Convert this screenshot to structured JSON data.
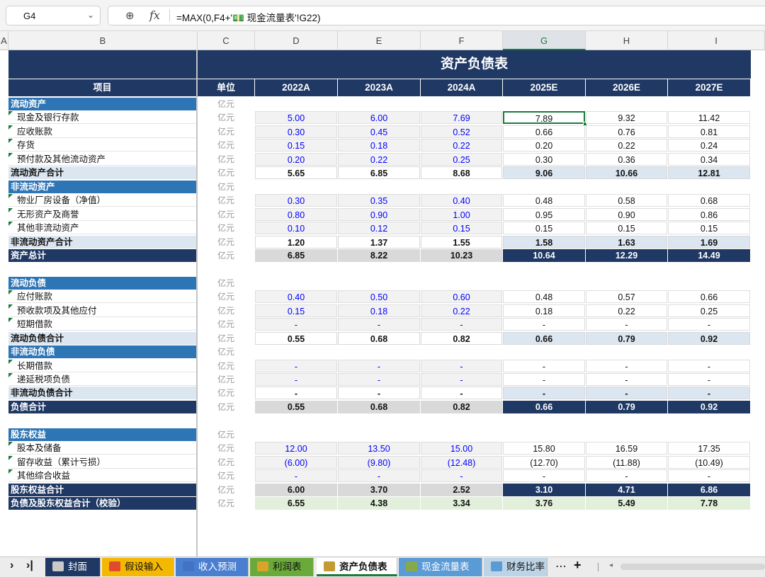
{
  "formula_bar": {
    "cell_ref": "G4",
    "formula": "=MAX(0,F4+'💵 现金流量表'!G22)",
    "zoom_icon": "zoom-icon",
    "fx_label": "fx"
  },
  "columns": [
    "A",
    "B",
    "C",
    "D",
    "E",
    "F",
    "G",
    "H",
    "I"
  ],
  "selected_column": "G",
  "sheet": {
    "title": "资产负债表",
    "header": {
      "item": "项目",
      "unit": "单位",
      "years": [
        "2022A",
        "2023A",
        "2024A",
        "2025E",
        "2026E",
        "2027E"
      ]
    },
    "rows": [
      {
        "label": "流动资产",
        "type": "section",
        "unit": "亿元",
        "values": [
          "",
          "",
          "",
          "",
          "",
          ""
        ]
      },
      {
        "label": "现金及银行存款",
        "type": "item",
        "unit": "亿元",
        "values": [
          "5.00",
          "6.00",
          "7.69",
          "7.89",
          "9.32",
          "11.42"
        ]
      },
      {
        "label": "应收账款",
        "type": "item",
        "unit": "亿元",
        "values": [
          "0.30",
          "0.45",
          "0.52",
          "0.66",
          "0.76",
          "0.81"
        ]
      },
      {
        "label": "存货",
        "type": "item",
        "unit": "亿元",
        "values": [
          "0.15",
          "0.18",
          "0.22",
          "0.20",
          "0.22",
          "0.24"
        ]
      },
      {
        "label": "预付款及其他流动资产",
        "type": "item",
        "unit": "亿元",
        "values": [
          "0.20",
          "0.22",
          "0.25",
          "0.30",
          "0.36",
          "0.34"
        ]
      },
      {
        "label": "流动资产合计",
        "type": "subtotal",
        "unit": "亿元",
        "values": [
          "5.65",
          "6.85",
          "8.68",
          "9.06",
          "10.66",
          "12.81"
        ]
      },
      {
        "label": "非流动资产",
        "type": "section",
        "unit": "亿元",
        "values": [
          "",
          "",
          "",
          "",
          "",
          ""
        ]
      },
      {
        "label": "物业厂房设备（净值）",
        "type": "item",
        "unit": "亿元",
        "values": [
          "0.30",
          "0.35",
          "0.40",
          "0.48",
          "0.58",
          "0.68"
        ]
      },
      {
        "label": "无形资产及商誉",
        "type": "item",
        "unit": "亿元",
        "values": [
          "0.80",
          "0.90",
          "1.00",
          "0.95",
          "0.90",
          "0.86"
        ]
      },
      {
        "label": "其他非流动资产",
        "type": "item",
        "unit": "亿元",
        "values": [
          "0.10",
          "0.12",
          "0.15",
          "0.15",
          "0.15",
          "0.15"
        ]
      },
      {
        "label": "非流动资产合计",
        "type": "subtotal",
        "unit": "亿元",
        "values": [
          "1.20",
          "1.37",
          "1.55",
          "1.58",
          "1.63",
          "1.69"
        ]
      },
      {
        "label": "资产总计",
        "type": "total",
        "unit": "亿元",
        "values": [
          "6.85",
          "8.22",
          "10.23",
          "10.64",
          "12.29",
          "14.49"
        ]
      },
      {
        "label": "",
        "type": "blank",
        "unit": "",
        "values": [
          "",
          "",
          "",
          "",
          "",
          ""
        ]
      },
      {
        "label": "流动负债",
        "type": "section",
        "unit": "亿元",
        "values": [
          "",
          "",
          "",
          "",
          "",
          ""
        ]
      },
      {
        "label": "应付账款",
        "type": "item",
        "unit": "亿元",
        "values": [
          "0.40",
          "0.50",
          "0.60",
          "0.48",
          "0.57",
          "0.66"
        ]
      },
      {
        "label": "预收款项及其他应付",
        "type": "item",
        "unit": "亿元",
        "values": [
          "0.15",
          "0.18",
          "0.22",
          "0.18",
          "0.22",
          "0.25"
        ]
      },
      {
        "label": "短期借款",
        "type": "item",
        "unit": "亿元",
        "values": [
          "-",
          "-",
          "-",
          "-",
          "-",
          "-"
        ]
      },
      {
        "label": "流动负债合计",
        "type": "subtotal",
        "unit": "亿元",
        "values": [
          "0.55",
          "0.68",
          "0.82",
          "0.66",
          "0.79",
          "0.92"
        ]
      },
      {
        "label": "非流动负债",
        "type": "section",
        "unit": "亿元",
        "values": [
          "",
          "",
          "",
          "",
          "",
          ""
        ]
      },
      {
        "label": "长期借款",
        "type": "item",
        "unit": "亿元",
        "values": [
          "-",
          "-",
          "-",
          "-",
          "-",
          "-"
        ]
      },
      {
        "label": "递延税项负债",
        "type": "item",
        "unit": "亿元",
        "values": [
          "-",
          "-",
          "-",
          "-",
          "-",
          "-"
        ]
      },
      {
        "label": "非流动负债合计",
        "type": "subtotal",
        "unit": "亿元",
        "values": [
          "-",
          "-",
          "-",
          "-",
          "-",
          "-"
        ]
      },
      {
        "label": "负债合计",
        "type": "total",
        "unit": "亿元",
        "values": [
          "0.55",
          "0.68",
          "0.82",
          "0.66",
          "0.79",
          "0.92"
        ]
      },
      {
        "label": "",
        "type": "blank",
        "unit": "",
        "values": [
          "",
          "",
          "",
          "",
          "",
          ""
        ]
      },
      {
        "label": "股东权益",
        "type": "section",
        "unit": "亿元",
        "values": [
          "",
          "",
          "",
          "",
          "",
          ""
        ]
      },
      {
        "label": "股本及储备",
        "type": "item",
        "unit": "亿元",
        "values": [
          "12.00",
          "13.50",
          "15.00",
          "15.80",
          "16.59",
          "17.35"
        ]
      },
      {
        "label": "留存收益（累计亏损）",
        "type": "item",
        "unit": "亿元",
        "values": [
          "(6.00)",
          "(9.80)",
          "(12.48)",
          "(12.70)",
          "(11.88)",
          "(10.49)"
        ]
      },
      {
        "label": "其他综合收益",
        "type": "item",
        "unit": "亿元",
        "values": [
          "-",
          "-",
          "-",
          "-",
          "-",
          "-"
        ]
      },
      {
        "label": "股东权益合计",
        "type": "total",
        "unit": "亿元",
        "values": [
          "6.00",
          "3.70",
          "2.52",
          "3.10",
          "4.71",
          "6.86"
        ]
      },
      {
        "label": "负债及股东权益合计（校验）",
        "type": "check",
        "unit": "亿元",
        "values": [
          "6.55",
          "4.38",
          "3.34",
          "3.76",
          "5.49",
          "7.78"
        ]
      }
    ]
  },
  "tab_nav": {
    "next": "›",
    "last": "›|",
    "more": "⋯",
    "add": "+"
  },
  "tabs": [
    {
      "label": "封面",
      "icon": "clipboard-icon",
      "active": false
    },
    {
      "label": "假设输入",
      "icon": "bar-chart-icon",
      "active": false
    },
    {
      "label": "收入预测",
      "icon": "line-chart-icon",
      "active": false
    },
    {
      "label": "利润表",
      "icon": "money-bag-icon",
      "active": false
    },
    {
      "label": "资产负债表",
      "icon": "bank-icon",
      "active": true
    },
    {
      "label": "现金流量表",
      "icon": "banknote-icon",
      "active": false
    },
    {
      "label": "财务比率",
      "icon": "ratio-chart-icon",
      "active": false
    }
  ],
  "colors": {
    "navy": "#1f3864",
    "section_blue": "#2e75b6",
    "subtotal_fill": "#dce6f1",
    "input_fill": "#f2f2f2",
    "total_gray": "#d9d9d9",
    "check_fill": "#e2efda",
    "input_font": "#0000ff",
    "selection_green": "#1a7a3a"
  }
}
